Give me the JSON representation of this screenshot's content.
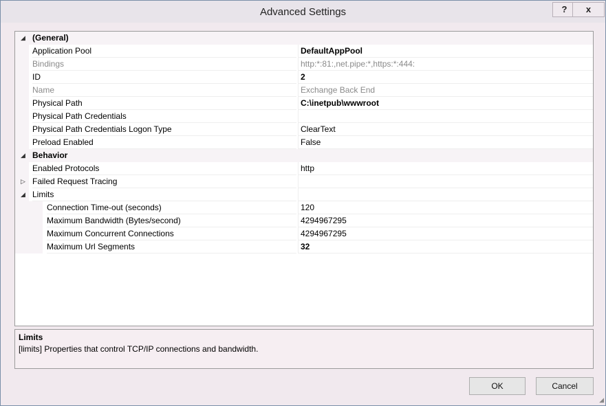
{
  "window": {
    "title": "Advanced Settings",
    "help_label": "?",
    "close_label": "x"
  },
  "grid": {
    "rows": [
      {
        "toggle": "◢",
        "name": "(General)",
        "value": ""
      },
      {
        "name": "Application Pool",
        "value": "DefaultAppPool"
      },
      {
        "name": "Bindings",
        "value": "http:*:81:,net.pipe:*,https:*:444:"
      },
      {
        "name": "ID",
        "value": "2"
      },
      {
        "name": "Name",
        "value": "Exchange Back End"
      },
      {
        "name": "Physical Path",
        "value": "C:\\inetpub\\wwwroot"
      },
      {
        "name": "Physical Path Credentials",
        "value": ""
      },
      {
        "name": "Physical Path Credentials Logon Type",
        "value": "ClearText"
      },
      {
        "name": "Preload Enabled",
        "value": "False"
      },
      {
        "toggle": "◢",
        "name": "Behavior",
        "value": ""
      },
      {
        "name": "Enabled Protocols",
        "value": "http"
      },
      {
        "toggle": "▷",
        "name": "Failed Request Tracing",
        "value": ""
      },
      {
        "toggle": "◢",
        "name": "Limits",
        "value": ""
      },
      {
        "name": "Connection Time-out (seconds)",
        "value": "120"
      },
      {
        "name": "Maximum Bandwidth (Bytes/second)",
        "value": "4294967295"
      },
      {
        "name": "Maximum Concurrent Connections",
        "value": "4294967295"
      },
      {
        "name": "Maximum Url Segments",
        "value": "32"
      }
    ]
  },
  "description": {
    "title": "Limits",
    "text": "[limits] Properties that control TCP/IP connections and bandwidth."
  },
  "buttons": {
    "ok": "OK",
    "cancel": "Cancel"
  }
}
